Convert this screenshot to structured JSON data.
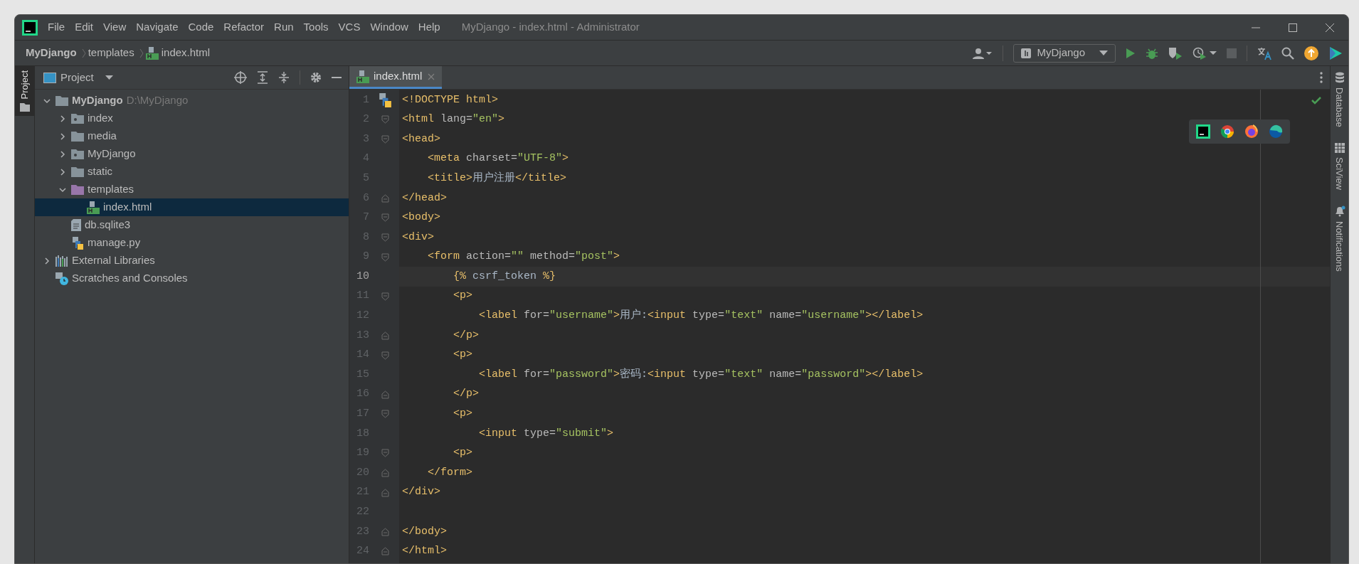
{
  "window": {
    "title": "MyDjango - index.html - Administrator"
  },
  "menu": [
    "File",
    "Edit",
    "View",
    "Navigate",
    "Code",
    "Refactor",
    "Run",
    "Tools",
    "VCS",
    "Window",
    "Help"
  ],
  "breadcrumb": [
    {
      "label": "MyDjango",
      "kind": "project"
    },
    {
      "label": "templates",
      "kind": "folder"
    },
    {
      "label": "index.html",
      "kind": "html"
    }
  ],
  "run_config": {
    "label": "MyDjango"
  },
  "left_strip": [
    {
      "label": "Project",
      "selected": true
    }
  ],
  "right_strip": [
    {
      "label": "Database",
      "kind": "database"
    },
    {
      "label": "SciView",
      "kind": "grid"
    },
    {
      "label": "Notifications",
      "kind": "bell"
    }
  ],
  "project_panel": {
    "title": "Project",
    "tree": [
      {
        "label": "MyDjango",
        "path": "D:\\MyDjango",
        "kind": "folder",
        "expanded": true,
        "selected": false,
        "children": [
          {
            "label": "index",
            "kind": "module",
            "expanded": false,
            "selected": false
          },
          {
            "label": "media",
            "kind": "folder",
            "expanded": false,
            "selected": false
          },
          {
            "label": "MyDjango",
            "kind": "module",
            "expanded": false,
            "selected": false
          },
          {
            "label": "static",
            "kind": "folder",
            "expanded": false,
            "selected": false
          },
          {
            "label": "templates",
            "kind": "templates",
            "expanded": true,
            "selected": false,
            "children": [
              {
                "label": "index.html",
                "kind": "html",
                "selected": true
              }
            ]
          },
          {
            "label": "db.sqlite3",
            "kind": "file",
            "selected": false
          },
          {
            "label": "manage.py",
            "kind": "python",
            "selected": false
          }
        ]
      },
      {
        "label": "External Libraries",
        "kind": "library",
        "expanded": false,
        "selected": false
      },
      {
        "label": "Scratches and Consoles",
        "kind": "scratches",
        "selected": false
      }
    ]
  },
  "tabs": [
    {
      "label": "index.html",
      "selected": true
    }
  ],
  "editor": {
    "lines": [
      {
        "number": "1",
        "current": false,
        "fold_start": false,
        "fold_end": false,
        "tokens": [
          {
            "kind": "tag",
            "text": "<!DOCTYPE html>"
          }
        ]
      },
      {
        "number": "2",
        "current": false,
        "fold_start": true,
        "fold_end": false,
        "tokens": [
          {
            "kind": "tag",
            "text": "<html "
          },
          {
            "kind": "attr",
            "text": "lang="
          },
          {
            "kind": "str",
            "text": "\"en\""
          },
          {
            "kind": "tag",
            "text": ">"
          }
        ]
      },
      {
        "number": "3",
        "current": false,
        "fold_start": true,
        "fold_end": false,
        "tokens": [
          {
            "kind": "tag",
            "text": "<head>"
          }
        ]
      },
      {
        "number": "4",
        "current": false,
        "fold_start": false,
        "fold_end": false,
        "tokens": [
          {
            "kind": "tag",
            "text": "    <meta "
          },
          {
            "kind": "attr",
            "text": "charset="
          },
          {
            "kind": "str",
            "text": "\"UTF-8\""
          },
          {
            "kind": "tag",
            "text": ">"
          }
        ]
      },
      {
        "number": "5",
        "current": false,
        "fold_start": false,
        "fold_end": false,
        "tokens": [
          {
            "kind": "tag",
            "text": "    <title>"
          },
          {
            "kind": "text",
            "text": "用户注册"
          },
          {
            "kind": "tag",
            "text": "</title>"
          }
        ]
      },
      {
        "number": "6",
        "current": false,
        "fold_start": false,
        "fold_end": true,
        "tokens": [
          {
            "kind": "tag",
            "text": "</head>"
          }
        ]
      },
      {
        "number": "7",
        "current": false,
        "fold_start": true,
        "fold_end": false,
        "tokens": [
          {
            "kind": "tag",
            "text": "<body>"
          }
        ]
      },
      {
        "number": "8",
        "current": false,
        "fold_start": true,
        "fold_end": false,
        "tokens": [
          {
            "kind": "tag",
            "text": "<div>"
          }
        ]
      },
      {
        "number": "9",
        "current": false,
        "fold_start": true,
        "fold_end": false,
        "tokens": [
          {
            "kind": "tag",
            "text": "    <form "
          },
          {
            "kind": "attr",
            "text": "action="
          },
          {
            "kind": "str",
            "text": "\"\""
          },
          {
            "kind": "attr",
            "text": " method="
          },
          {
            "kind": "str",
            "text": "\"post\""
          },
          {
            "kind": "tag",
            "text": ">"
          }
        ]
      },
      {
        "number": "10",
        "current": true,
        "fold_start": false,
        "fold_end": false,
        "tokens": [
          {
            "kind": "tag",
            "text": "        {%"
          },
          {
            "kind": "text",
            "text": " csrf_token "
          },
          {
            "kind": "tag",
            "text": "%}"
          }
        ]
      },
      {
        "number": "11",
        "current": false,
        "fold_start": true,
        "fold_end": false,
        "tokens": [
          {
            "kind": "tag",
            "text": "        <p>"
          }
        ]
      },
      {
        "number": "12",
        "current": false,
        "fold_start": false,
        "fold_end": false,
        "tokens": [
          {
            "kind": "tag",
            "text": "            <label "
          },
          {
            "kind": "attr",
            "text": "for="
          },
          {
            "kind": "str",
            "text": "\"username\""
          },
          {
            "kind": "tag",
            "text": ">"
          },
          {
            "kind": "text",
            "text": "用户:"
          },
          {
            "kind": "tag",
            "text": "<input "
          },
          {
            "kind": "attr",
            "text": "type="
          },
          {
            "kind": "str",
            "text": "\"text\""
          },
          {
            "kind": "attr",
            "text": " name="
          },
          {
            "kind": "str",
            "text": "\"username\""
          },
          {
            "kind": "tag",
            "text": "></label>"
          }
        ]
      },
      {
        "number": "13",
        "current": false,
        "fold_start": false,
        "fold_end": true,
        "tokens": [
          {
            "kind": "tag",
            "text": "        </p>"
          }
        ]
      },
      {
        "number": "14",
        "current": false,
        "fold_start": true,
        "fold_end": false,
        "tokens": [
          {
            "kind": "tag",
            "text": "        <p>"
          }
        ]
      },
      {
        "number": "15",
        "current": false,
        "fold_start": false,
        "fold_end": false,
        "tokens": [
          {
            "kind": "tag",
            "text": "            <label "
          },
          {
            "kind": "attr",
            "text": "for="
          },
          {
            "kind": "str",
            "text": "\"password\""
          },
          {
            "kind": "tag",
            "text": ">"
          },
          {
            "kind": "text",
            "text": "密码:"
          },
          {
            "kind": "tag",
            "text": "<input "
          },
          {
            "kind": "attr",
            "text": "type="
          },
          {
            "kind": "str",
            "text": "\"text\""
          },
          {
            "kind": "attr",
            "text": " name="
          },
          {
            "kind": "str",
            "text": "\"password\""
          },
          {
            "kind": "tag",
            "text": "></label>"
          }
        ]
      },
      {
        "number": "16",
        "current": false,
        "fold_start": false,
        "fold_end": true,
        "tokens": [
          {
            "kind": "tag",
            "text": "        </p>"
          }
        ]
      },
      {
        "number": "17",
        "current": false,
        "fold_start": true,
        "fold_end": false,
        "tokens": [
          {
            "kind": "tag",
            "text": "        <p>"
          }
        ]
      },
      {
        "number": "18",
        "current": false,
        "fold_start": false,
        "fold_end": false,
        "tokens": [
          {
            "kind": "tag",
            "text": "            <input "
          },
          {
            "kind": "attr",
            "text": "type="
          },
          {
            "kind": "str",
            "text": "\"submit\""
          },
          {
            "kind": "tag",
            "text": ">"
          }
        ]
      },
      {
        "number": "19",
        "current": false,
        "fold_start": true,
        "fold_end": false,
        "tokens": [
          {
            "kind": "tag",
            "text": "        <p>"
          }
        ]
      },
      {
        "number": "20",
        "current": false,
        "fold_start": false,
        "fold_end": true,
        "tokens": [
          {
            "kind": "tag",
            "text": "    </form>"
          }
        ]
      },
      {
        "number": "21",
        "current": false,
        "fold_start": false,
        "fold_end": true,
        "tokens": [
          {
            "kind": "tag",
            "text": "</div>"
          }
        ]
      },
      {
        "number": "22",
        "current": false,
        "fold_start": false,
        "fold_end": false
      },
      {
        "number": "23",
        "current": false,
        "fold_start": false,
        "fold_end": true,
        "tokens": [
          {
            "kind": "tag",
            "text": "</body>"
          }
        ]
      },
      {
        "number": "24",
        "current": false,
        "fold_start": false,
        "fold_end": true,
        "tokens": [
          {
            "kind": "tag",
            "text": "</html>"
          }
        ]
      }
    ]
  }
}
